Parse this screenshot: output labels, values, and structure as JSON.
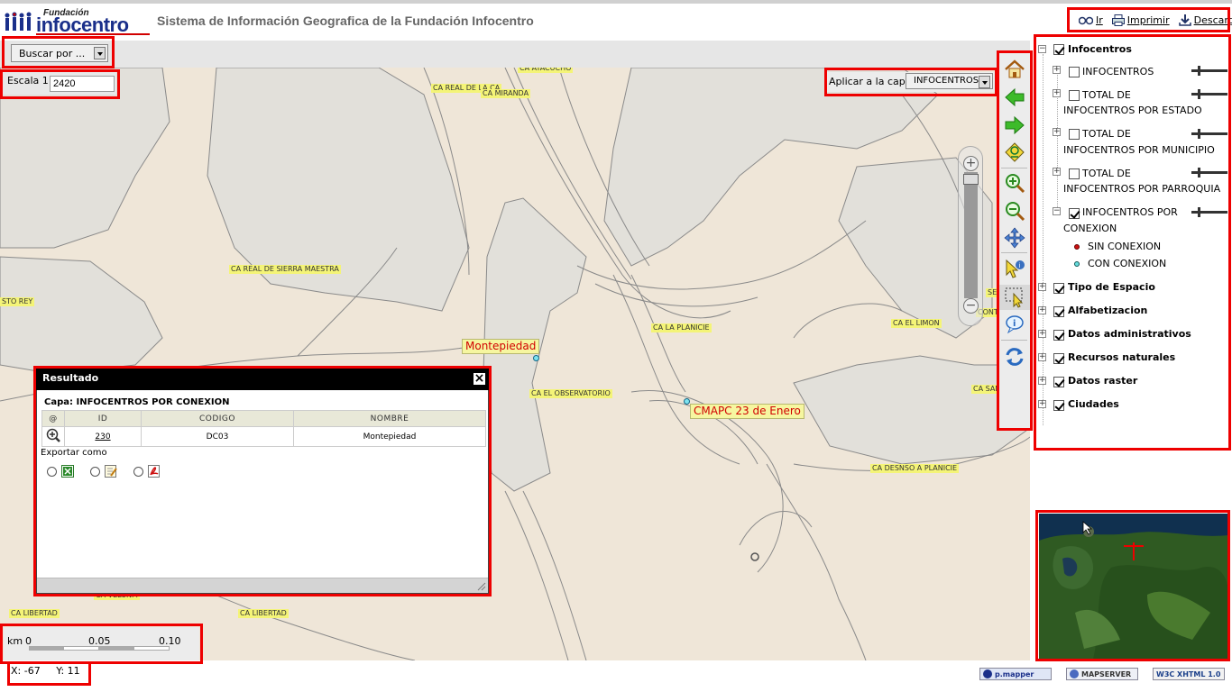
{
  "header": {
    "logo_small": "Fundación",
    "logo_big": "infocentro",
    "title": "Sistema de Información Geografica de la Fundación Infocentro",
    "links": {
      "go": "Ir",
      "print": "Imprimir",
      "download": "Descargar"
    }
  },
  "search": {
    "selected": "Buscar por ..."
  },
  "scale": {
    "label": "Escala 1:",
    "value": "2420"
  },
  "apply_layer": {
    "label": "Aplicar a la capa",
    "selected": "INFOCENTROS"
  },
  "map": {
    "streets": [
      "CA AYACUCHO",
      "CA REAL DE LA CA",
      "CA MIRANDA",
      "CA REAL DE SIERRA MAESTRA",
      "STO REY",
      "CA LA PLANICIE",
      "CA EL LIMON",
      "CA EL OBSERVATORIO",
      "CA SAN",
      "SEC",
      "CONTE",
      "CA DESNSO A PLANICIE",
      "CA VELUNM",
      "CA LIBERTAD",
      "CA LIBERTAD"
    ],
    "pois": [
      "Montepiedad",
      "CMAPC 23 de Enero"
    ]
  },
  "layers": {
    "groups": [
      "Infocentros",
      "Tipo de Espacio",
      "Alfabetizacion",
      "Datos administrativos",
      "Recursos naturales",
      "Datos raster",
      "Ciudades"
    ],
    "sublayers": [
      {
        "line1": "INFOCENTROS",
        "line2": ""
      },
      {
        "line1": "TOTAL DE",
        "line2": "INFOCENTROS POR ESTADO"
      },
      {
        "line1": "TOTAL DE",
        "line2": "INFOCENTROS POR MUNICIPIO"
      },
      {
        "line1": "TOTAL DE",
        "line2": "INFOCENTROS POR PARROQUIA"
      },
      {
        "line1": "INFOCENTROS POR",
        "line2": "CONEXION"
      }
    ],
    "legend": [
      {
        "label": "SIN CONEXION",
        "color": "#cc1111"
      },
      {
        "label": "CON CONEXION",
        "color": "#66dddd"
      }
    ]
  },
  "result": {
    "title": "Resultado",
    "layer": "Capa: INFOCENTROS POR CONEXION",
    "columns": [
      "@",
      "ID",
      "CODIGO",
      "NOMBRE"
    ],
    "row": {
      "id": "230",
      "codigo": "DC03",
      "nombre": "Montepiedad"
    },
    "export_label": "Exportar como"
  },
  "scalebar": {
    "unit": "km",
    "ticks": [
      "0",
      "0.05",
      "0.10"
    ]
  },
  "coords": {
    "x": "X: -67",
    "y": "Y: 11"
  },
  "badges": {
    "pmapper": "p.mapper",
    "mapserver": "MAPSERVER",
    "xhtml": "W3C XHTML 1.0"
  },
  "colors": {
    "brand": "#1a2f8a",
    "highlight": "#ee0000",
    "map_bg": "#efe6d8",
    "block_gray": "#e2e0da"
  }
}
